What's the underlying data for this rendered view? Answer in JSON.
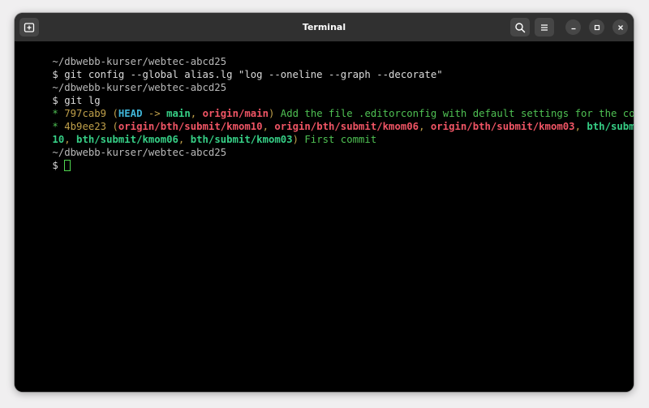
{
  "window": {
    "title": "Terminal"
  },
  "terminal": {
    "lines": [
      {
        "path": "~/dbwebb-kurser/webtec-abcd25"
      },
      {
        "prompt": "$",
        "command": " git config --global alias.lg \"log --oneline --graph --decorate\""
      },
      {
        "path": "~/dbwebb-kurser/webtec-abcd25"
      },
      {
        "prompt": "$",
        "command": " git lg"
      }
    ],
    "log": [
      {
        "graph": "* ",
        "hash": "797cab9",
        "open": " (",
        "head": "HEAD",
        "arrow": " -> ",
        "branch": "main",
        "sep1": ", ",
        "remote": "origin/main",
        "close": ")",
        "message": " Add the file .editorconfig with default settings for the course"
      },
      {
        "graph": "* ",
        "hash": "4b9ee23",
        "open": " (",
        "r1": "origin/bth/submit/kmom10",
        "sep1": ", ",
        "r2": "origin/bth/submit/kmom06",
        "sep2": ", ",
        "r3": "origin/bth/submit/kmom03",
        "sep3": ", ",
        "l1a": "bth/submit/kmom",
        "l1b": "10",
        "sep4": ", ",
        "l2": "bth/submit/kmom06",
        "sep5": ", ",
        "l3": "bth/submit/kmom03",
        "close": ")",
        "message": " First commit"
      }
    ],
    "final_path": "~/dbwebb-kurser/webtec-abcd25",
    "final_prompt": "$ "
  },
  "colors": {
    "background": "#000000",
    "titlebar": "#303030",
    "prompt_green": "#4fc153",
    "head_cyan": "#3fb5d8",
    "branch_green": "#36cf86",
    "remote_red": "#f05565",
    "hash_yellow": "#c0a04a"
  },
  "icons": {
    "new_tab": "new-tab-icon",
    "search": "search-icon",
    "menu": "hamburger-menu-icon",
    "minimize": "minimize-icon",
    "maximize": "maximize-icon",
    "close": "close-icon"
  }
}
